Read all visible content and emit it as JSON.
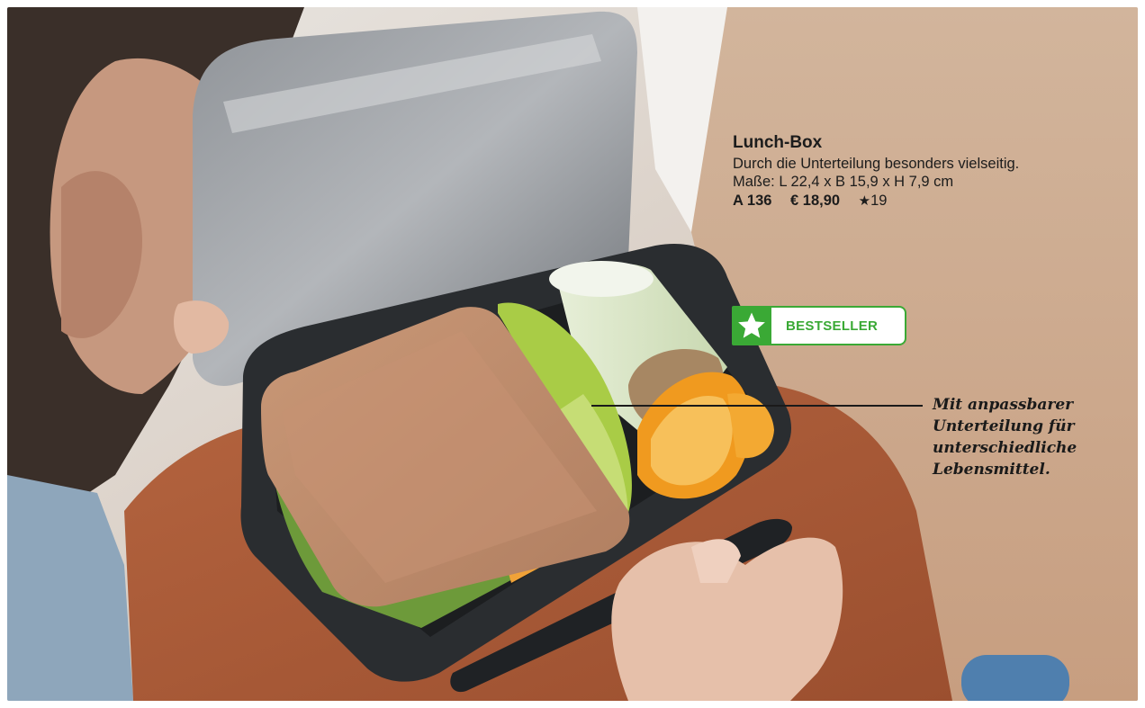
{
  "product": {
    "title": "Lunch-Box",
    "description": "Durch die Unterteilung besonders vielseitig.",
    "dimensions": "Maße: L 22,4 x B 15,9 x H 7,9 cm",
    "article_code": "A 136",
    "price": "€ 18,90",
    "star_symbol": "★",
    "points": "19"
  },
  "badge": {
    "label": "BESTSELLER",
    "icon": "star-icon",
    "color": "#3aa935"
  },
  "callout": {
    "lines": [
      "Mit anpassbarer",
      "Unterteilung für",
      "unterschiedliche",
      "Lebensmittel."
    ]
  }
}
